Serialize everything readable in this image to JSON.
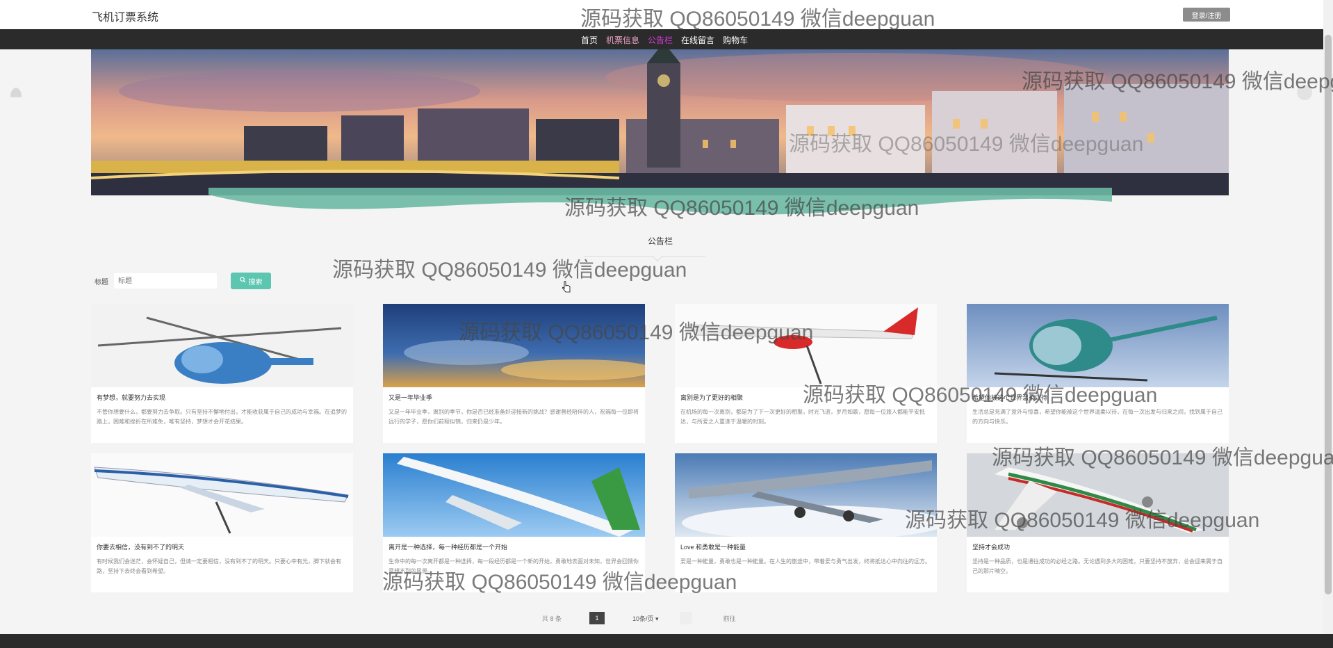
{
  "header": {
    "site_title": "飞机订票系统",
    "login_label": "登录/注册"
  },
  "nav": {
    "items": [
      {
        "label": "首页",
        "active": false
      },
      {
        "label": "机票信息",
        "active": false
      },
      {
        "label": "公告栏",
        "active": true
      },
      {
        "label": "在线留言",
        "active": false
      },
      {
        "label": "购物车",
        "active": false
      }
    ]
  },
  "section": {
    "title": "公告栏"
  },
  "search": {
    "label": "标题",
    "placeholder": "标题",
    "button_label": "搜索"
  },
  "cards": [
    {
      "title": "有梦想，就要努力去实现",
      "desc": "不管你想要什么，都要努力去争取。只有坚持不懈地付出，才能收获属于自己的成功与幸福。在追梦的路上，困难和挫折在所难免，唯有坚持，梦想才会开花结果。",
      "image": "helicopter-blue"
    },
    {
      "title": "又是一年毕业季",
      "desc": "又是一年毕业季，离别的季节，你是否已经准备好迎接新的挑战？感谢曾经陪伴的人，祝福每一位即将远行的学子，愿你们前程似锦，归来仍是少年。",
      "image": "sky-sunset"
    },
    {
      "title": "离别是为了更好的相聚",
      "desc": "在机场的每一次离别，都是为了下一次更好的相聚。时光飞逝，岁月如歌，愿每一位旅人都能平安抵达，与所爱之人重逢于温暖的时刻。",
      "image": "airliner-red"
    },
    {
      "title": "希望你被这个世界温柔以待",
      "desc": "生活总是充满了意外与惊喜，希望你能被这个世界温柔以待，在每一次出发与归来之间，找到属于自己的方向与快乐。",
      "image": "helicopter-teal"
    },
    {
      "title": "你要去相信，没有到不了的明天",
      "desc": "有时候我们会迷茫，会怀疑自己，但请一定要相信，没有到不了的明天。只要心中有光，脚下就会有路，坚持下去终会看到希望。",
      "image": "air-force-one"
    },
    {
      "title": "离开是一种选择，每一种经历都是一个开始",
      "desc": "生命中的每一次离开都是一种选择，每一段经历都是一个新的开始，勇敢地去面对未知，世界会回馈你意想不到的风景。",
      "image": "c919-plane"
    },
    {
      "title": "Love 和勇敢是一种能量",
      "desc": "爱是一种能量，勇敢也是一种能量。在人生的旅途中，带着爱与勇气出发，终将抵达心中向往的远方。",
      "image": "airliner-clouds"
    },
    {
      "title": "坚持才会成功",
      "desc": "坚持是一种品质，也是通往成功的必经之路。无论遇到多大的困难，只要坚持不放弃，总会迎来属于自己的那片晴空。",
      "image": "airliner-stripes"
    }
  ],
  "pagination": {
    "total_label": "共 8 条",
    "current_page": "1",
    "page_size_label": "10条/页",
    "goto_label": "前往"
  },
  "watermark": {
    "text": "源码获取 QQ86050149 微信deepguan"
  },
  "colors": {
    "nav_bg": "#2b2b2b",
    "nav_active": "#d63bd6",
    "accent_green": "#5cc6b0",
    "wave_green": "#6bb9a3"
  }
}
